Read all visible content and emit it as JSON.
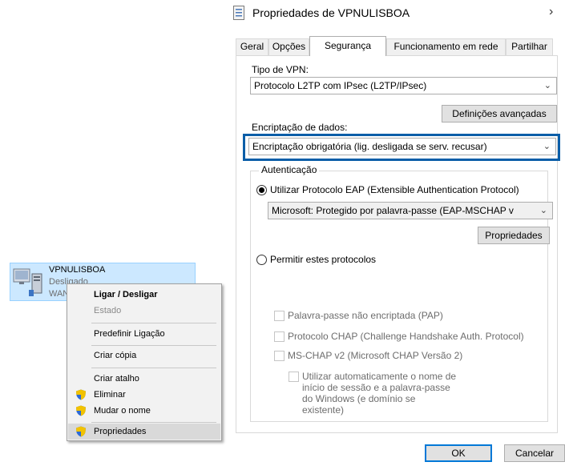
{
  "dialog": {
    "title": "Propriedades de VPNULISBOA",
    "close_glyph": "›",
    "tabs": [
      "Geral",
      "Opções",
      "Segurança",
      "Funcionamento em rede",
      "Partilhar"
    ],
    "active_tab": "Segurança",
    "vpn_type_label": "Tipo de VPN:",
    "vpn_type_value": "Protocolo L2TP com IPsec (L2TP/IPsec)",
    "advanced_button": "Definições avançadas",
    "encryption_label": "Encriptação de dados:",
    "encryption_value": "Encriptação obrigatória (lig. desligada se serv. recusar)",
    "auth_group_label": "Autenticação",
    "eap_radio_label": "Utilizar Protocolo EAP (Extensible Authentication Protocol)",
    "eap_method_value": "Microsoft: Protegido por palavra-passe (EAP-MSCHAP v",
    "properties_button": "Propriedades",
    "protocols_radio_label": "Permitir estes protocolos",
    "protocols": [
      "Palavra-passe não encriptada (PAP)",
      "Protocolo CHAP (Challenge Handshake Auth. Protocol)",
      "MS-CHAP v2 (Microsoft CHAP Versão 2)"
    ],
    "auto_logon_label": "Utilizar automaticamente o nome de início de sessão e a palavra-passe do Windows (e domínio se existente)",
    "ok_button": "OK",
    "cancel_button": "Cancelar",
    "highlight_color": "#0b5ea8"
  },
  "connection": {
    "name": "VPNULISBOA",
    "status": "Desligado",
    "type": "WAN"
  },
  "context_menu": {
    "items": [
      {
        "label": "Ligar / Desligar",
        "bold": true
      },
      {
        "label": "Estado",
        "disabled": true
      },
      {
        "label": "Predefinir Ligação"
      },
      {
        "label": "Criar cópia"
      },
      {
        "label": "Criar atalho"
      },
      {
        "label": "Eliminar",
        "icon": "shield-icon"
      },
      {
        "label": "Mudar o nome",
        "icon": "shield-icon"
      },
      {
        "label": "Propriedades",
        "icon": "shield-icon",
        "hover": true
      }
    ]
  }
}
